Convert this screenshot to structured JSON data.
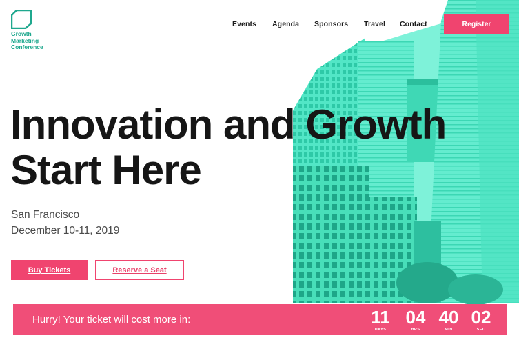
{
  "brand": {
    "logo_lines": [
      "Growth",
      "Marketing",
      "Conference"
    ],
    "accent": "#f0446f",
    "teal": "#3ee0bd"
  },
  "nav": {
    "items": [
      "Events",
      "Agenda",
      "Sponsors",
      "Travel",
      "Contact"
    ],
    "register_label": "Register"
  },
  "hero": {
    "headline_line1": "Innovation and Growth",
    "headline_line2": "Start Here",
    "location": "San Francisco",
    "dates": "December 10-11, 2019",
    "buy_label": "Buy Tickets",
    "reserve_label": "Reserve a Seat"
  },
  "countdown": {
    "message": "Hurry! Your ticket will cost more in:",
    "days": "11",
    "days_label": "DAYS",
    "hours": "04",
    "hours_label": "HRS",
    "minutes": "40",
    "minutes_label": "MIN",
    "seconds": "02",
    "seconds_label": "SEC"
  }
}
